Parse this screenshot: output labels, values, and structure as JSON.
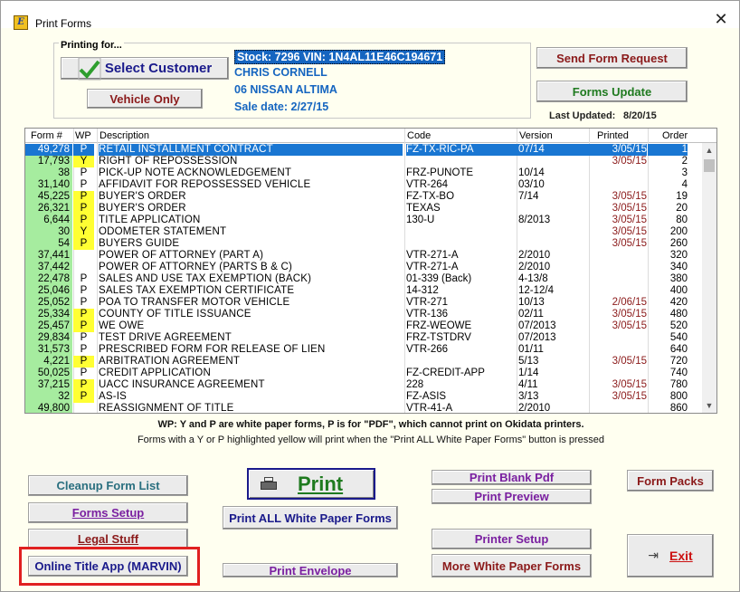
{
  "window": {
    "title": "Print Forms",
    "close_glyph": "✕",
    "icon": "app-logo-icon"
  },
  "printing_for": {
    "label": "Printing for...",
    "select_customer": "Select Customer",
    "vehicle_only": "Vehicle Only",
    "stock_line": "Stock: 7296  VIN: 1N4AL11E46C194671",
    "customer_name": "CHRIS CORNELL",
    "vehicle": "06 NISSAN ALTIMA",
    "sale_date_label": "Sale date:  2/27/15"
  },
  "right_panel": {
    "send_form_request": "Send Form Request",
    "forms_update": "Forms Update",
    "last_updated_label": "Last Updated:",
    "last_updated_value": "8/20/15"
  },
  "grid": {
    "headers": {
      "form": "Form #",
      "wp": "WP",
      "desc": "Description",
      "code": "Code",
      "version": "Version",
      "printed": "Printed",
      "order": "Order"
    },
    "rows": [
      {
        "form": "49,278",
        "wp": "P",
        "desc": "RETAIL INSTALLMENT CONTRACT",
        "code": "FZ-TX-RIC-PA",
        "version": "07/14",
        "printed": "3/05/15",
        "order": "1"
      },
      {
        "form": "17,793",
        "wp": "Y",
        "desc": "RIGHT OF REPOSSESSION",
        "code": "",
        "version": "",
        "printed": "3/05/15",
        "order": "2"
      },
      {
        "form": "38",
        "wp": "P",
        "desc": "PICK-UP NOTE ACKNOWLEDGEMENT",
        "code": "FRZ-PUNOTE",
        "version": "10/14",
        "printed": "",
        "order": "3"
      },
      {
        "form": "31,140",
        "wp": "P",
        "desc": "AFFIDAVIT FOR REPOSSESSED VEHICLE",
        "code": "VTR-264",
        "version": "03/10",
        "printed": "",
        "order": "4"
      },
      {
        "form": "45,225",
        "wp": "P",
        "desc": "BUYER'S ORDER",
        "code": "FZ-TX-BO",
        "version": "7/14",
        "printed": "3/05/15",
        "order": "19"
      },
      {
        "form": "26,321",
        "wp": "P",
        "desc": "BUYER'S ORDER",
        "code": "TEXAS",
        "version": "",
        "printed": "3/05/15",
        "order": "20"
      },
      {
        "form": "6,644",
        "wp": "P",
        "desc": "TITLE APPLICATION",
        "code": "130-U",
        "version": "8/2013",
        "printed": "3/05/15",
        "order": "80"
      },
      {
        "form": "30",
        "wp": "Y",
        "desc": "ODOMETER STATEMENT",
        "code": "",
        "version": "",
        "printed": "3/05/15",
        "order": "200"
      },
      {
        "form": "54",
        "wp": "P",
        "desc": "BUYERS GUIDE",
        "code": "",
        "version": "",
        "printed": "3/05/15",
        "order": "260"
      },
      {
        "form": "37,441",
        "wp": "",
        "desc": "POWER OF ATTORNEY (PART A)",
        "code": "VTR-271-A",
        "version": "2/2010",
        "printed": "",
        "order": "320"
      },
      {
        "form": "37,442",
        "wp": "",
        "desc": "POWER OF ATTORNEY (PARTS B & C)",
        "code": "VTR-271-A",
        "version": "2/2010",
        "printed": "",
        "order": "340"
      },
      {
        "form": "22,478",
        "wp": "P",
        "desc": "SALES AND USE TAX EXEMPTION (BACK)",
        "code": "01-339 (Back)",
        "version": "4-13/8",
        "printed": "",
        "order": "380"
      },
      {
        "form": "25,046",
        "wp": "P",
        "desc": "SALES TAX EXEMPTION CERTIFICATE",
        "code": "14-312",
        "version": "12-12/4",
        "printed": "",
        "order": "400"
      },
      {
        "form": "25,052",
        "wp": "P",
        "desc": "POA TO TRANSFER MOTOR VEHICLE",
        "code": "VTR-271",
        "version": "10/13",
        "printed": "2/06/15",
        "order": "420"
      },
      {
        "form": "25,334",
        "wp": "P",
        "desc": "COUNTY OF TITLE ISSUANCE",
        "code": "VTR-136",
        "version": "02/11",
        "printed": "3/05/15",
        "order": "480"
      },
      {
        "form": "25,457",
        "wp": "P",
        "desc": "WE OWE",
        "code": "FRZ-WEOWE",
        "version": "07/2013",
        "printed": "3/05/15",
        "order": "520"
      },
      {
        "form": "29,834",
        "wp": "P",
        "desc": "TEST DRIVE AGREEMENT",
        "code": "FRZ-TSTDRV",
        "version": "07/2013",
        "printed": "",
        "order": "540"
      },
      {
        "form": "31,573",
        "wp": "P",
        "desc": "PRESCRIBED FORM FOR RELEASE OF LIEN",
        "code": "VTR-266",
        "version": "01/11",
        "printed": "",
        "order": "640"
      },
      {
        "form": "4,221",
        "wp": "P",
        "desc": "ARBITRATION AGREEMENT",
        "code": "",
        "version": "5/13",
        "printed": "3/05/15",
        "order": "720"
      },
      {
        "form": "50,025",
        "wp": "P",
        "desc": "CREDIT APPLICATION",
        "code": "FZ-CREDIT-APP",
        "version": "1/14",
        "printed": "",
        "order": "740"
      },
      {
        "form": "37,215",
        "wp": "P",
        "desc": "UACC INSURANCE AGREEMENT",
        "code": "228",
        "version": "4/11",
        "printed": "3/05/15",
        "order": "780"
      },
      {
        "form": "32",
        "wp": "P",
        "desc": "AS-IS",
        "code": "FZ-ASIS",
        "version": "3/13",
        "printed": "3/05/15",
        "order": "800"
      },
      {
        "form": "49,800",
        "wp": "",
        "desc": "REASSIGNMENT OF TITLE",
        "code": "VTR-41-A",
        "version": "2/2010",
        "printed": "",
        "order": "860"
      }
    ]
  },
  "notes": {
    "line1": "WP: Y and P are white paper forms, P is for \"PDF\", which cannot print on Okidata printers.",
    "line2": "Forms with a Y or P highlighted yellow will print when the \"Print ALL White Paper Forms\" button is pressed"
  },
  "buttons": {
    "cleanup": "Cleanup Form List",
    "forms_setup": "Forms Setup",
    "legal_stuff": "Legal Stuff",
    "online_title_app": "Online Title App (MARVIN)",
    "print": "Print",
    "print_all_white": "Print ALL White Paper Forms",
    "print_envelope": "Print Envelope",
    "print_blank_pdf": "Print Blank Pdf",
    "print_preview": "Print Preview",
    "printer_setup": "Printer Setup",
    "more_white_paper": "More White Paper Forms",
    "form_packs": "Form Packs",
    "exit": "Exit"
  },
  "colors": {
    "accent_blue": "#1565c0",
    "form_green": "#a6ec9f",
    "wp_yellow": "#ffff33",
    "printed_red": "#8b1a1a",
    "highlight_red": "#e02020"
  }
}
